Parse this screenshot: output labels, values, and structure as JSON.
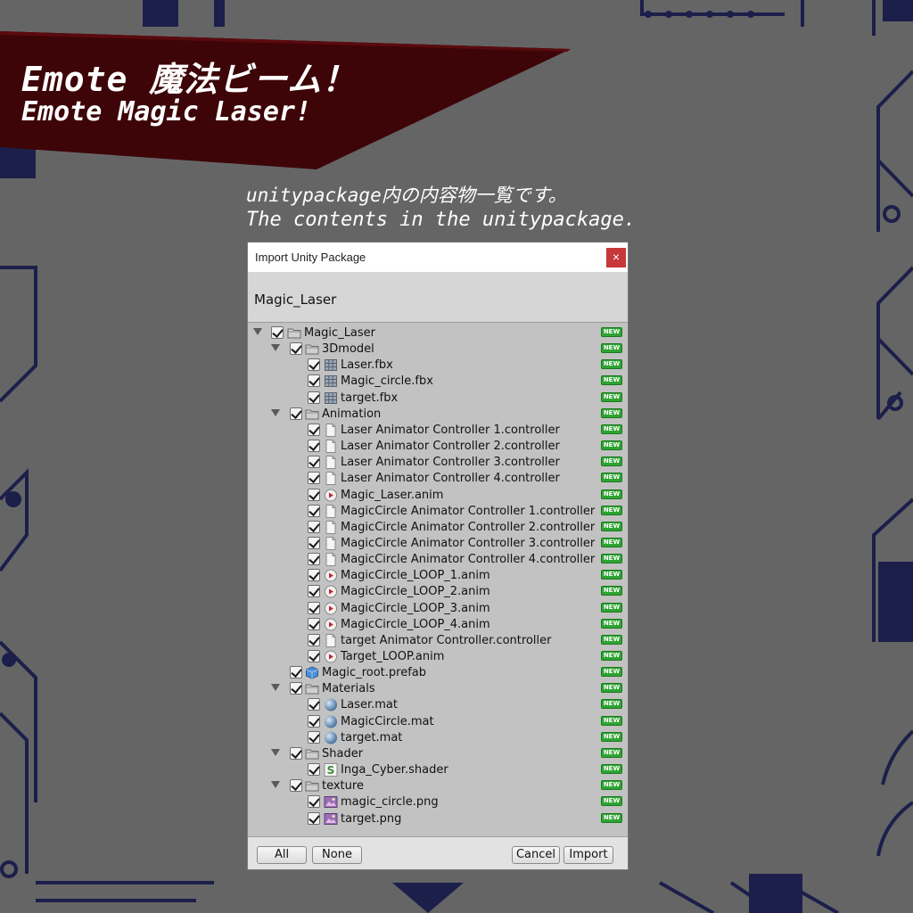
{
  "banner": {
    "title_jp": "Emote 魔法ビーム！",
    "title_en": "Emote Magic Laser!",
    "subtitle_jp": "unitypackage内の内容物一覧です。",
    "subtitle_en": "The contents in the unitypackage.",
    "color": "#3d0508"
  },
  "dialog": {
    "title": "Import Unity Package",
    "close_label": "×",
    "package_name": "Magic_Laser",
    "badge_label": "NEW",
    "badge_color": "#2fa332",
    "items": [
      {
        "label": "Magic_Laser",
        "depth": 0,
        "icon": "folder-icon",
        "expandable": true
      },
      {
        "label": "3Dmodel",
        "depth": 1,
        "icon": "folder-icon",
        "expandable": true
      },
      {
        "label": "Laser.fbx",
        "depth": 2,
        "icon": "mesh-icon"
      },
      {
        "label": "Magic_circle.fbx",
        "depth": 2,
        "icon": "mesh-icon"
      },
      {
        "label": "target.fbx",
        "depth": 2,
        "icon": "mesh-icon"
      },
      {
        "label": "Animation",
        "depth": 1,
        "icon": "folder-icon",
        "expandable": true
      },
      {
        "label": "Laser Animator Controller 1.controller",
        "depth": 2,
        "icon": "file-icon"
      },
      {
        "label": "Laser Animator Controller 2.controller",
        "depth": 2,
        "icon": "file-icon"
      },
      {
        "label": "Laser Animator Controller 3.controller",
        "depth": 2,
        "icon": "file-icon"
      },
      {
        "label": "Laser Animator Controller 4.controller",
        "depth": 2,
        "icon": "file-icon"
      },
      {
        "label": "Magic_Laser.anim",
        "depth": 2,
        "icon": "animation-icon"
      },
      {
        "label": "MagicCircle Animator Controller 1.controller",
        "depth": 2,
        "icon": "file-icon"
      },
      {
        "label": "MagicCircle Animator Controller 2.controller",
        "depth": 2,
        "icon": "file-icon"
      },
      {
        "label": "MagicCircle Animator Controller 3.controller",
        "depth": 2,
        "icon": "file-icon"
      },
      {
        "label": "MagicCircle Animator Controller 4.controller",
        "depth": 2,
        "icon": "file-icon"
      },
      {
        "label": "MagicCircle_LOOP_1.anim",
        "depth": 2,
        "icon": "animation-icon"
      },
      {
        "label": "MagicCircle_LOOP_2.anim",
        "depth": 2,
        "icon": "animation-icon"
      },
      {
        "label": "MagicCircle_LOOP_3.anim",
        "depth": 2,
        "icon": "animation-icon"
      },
      {
        "label": "MagicCircle_LOOP_4.anim",
        "depth": 2,
        "icon": "animation-icon"
      },
      {
        "label": "target Animator Controller.controller",
        "depth": 2,
        "icon": "file-icon"
      },
      {
        "label": "Target_LOOP.anim",
        "depth": 2,
        "icon": "animation-icon"
      },
      {
        "label": "Magic_root.prefab",
        "depth": 1,
        "icon": "prefab-icon"
      },
      {
        "label": "Materials",
        "depth": 1,
        "icon": "folder-icon",
        "expandable": true
      },
      {
        "label": "Laser.mat",
        "depth": 2,
        "icon": "material-icon"
      },
      {
        "label": "MagicCircle.mat",
        "depth": 2,
        "icon": "material-icon"
      },
      {
        "label": "target.mat",
        "depth": 2,
        "icon": "material-icon"
      },
      {
        "label": "Shader",
        "depth": 1,
        "icon": "folder-icon",
        "expandable": true
      },
      {
        "label": "Inga_Cyber.shader",
        "depth": 2,
        "icon": "shader-icon"
      },
      {
        "label": "texture",
        "depth": 1,
        "icon": "folder-icon",
        "expandable": true
      },
      {
        "label": "magic_circle.png",
        "depth": 2,
        "icon": "image-icon"
      },
      {
        "label": "target.png",
        "depth": 2,
        "icon": "image-icon"
      }
    ],
    "buttons": {
      "all": "All",
      "none": "None",
      "cancel": "Cancel",
      "import": "Import"
    }
  }
}
